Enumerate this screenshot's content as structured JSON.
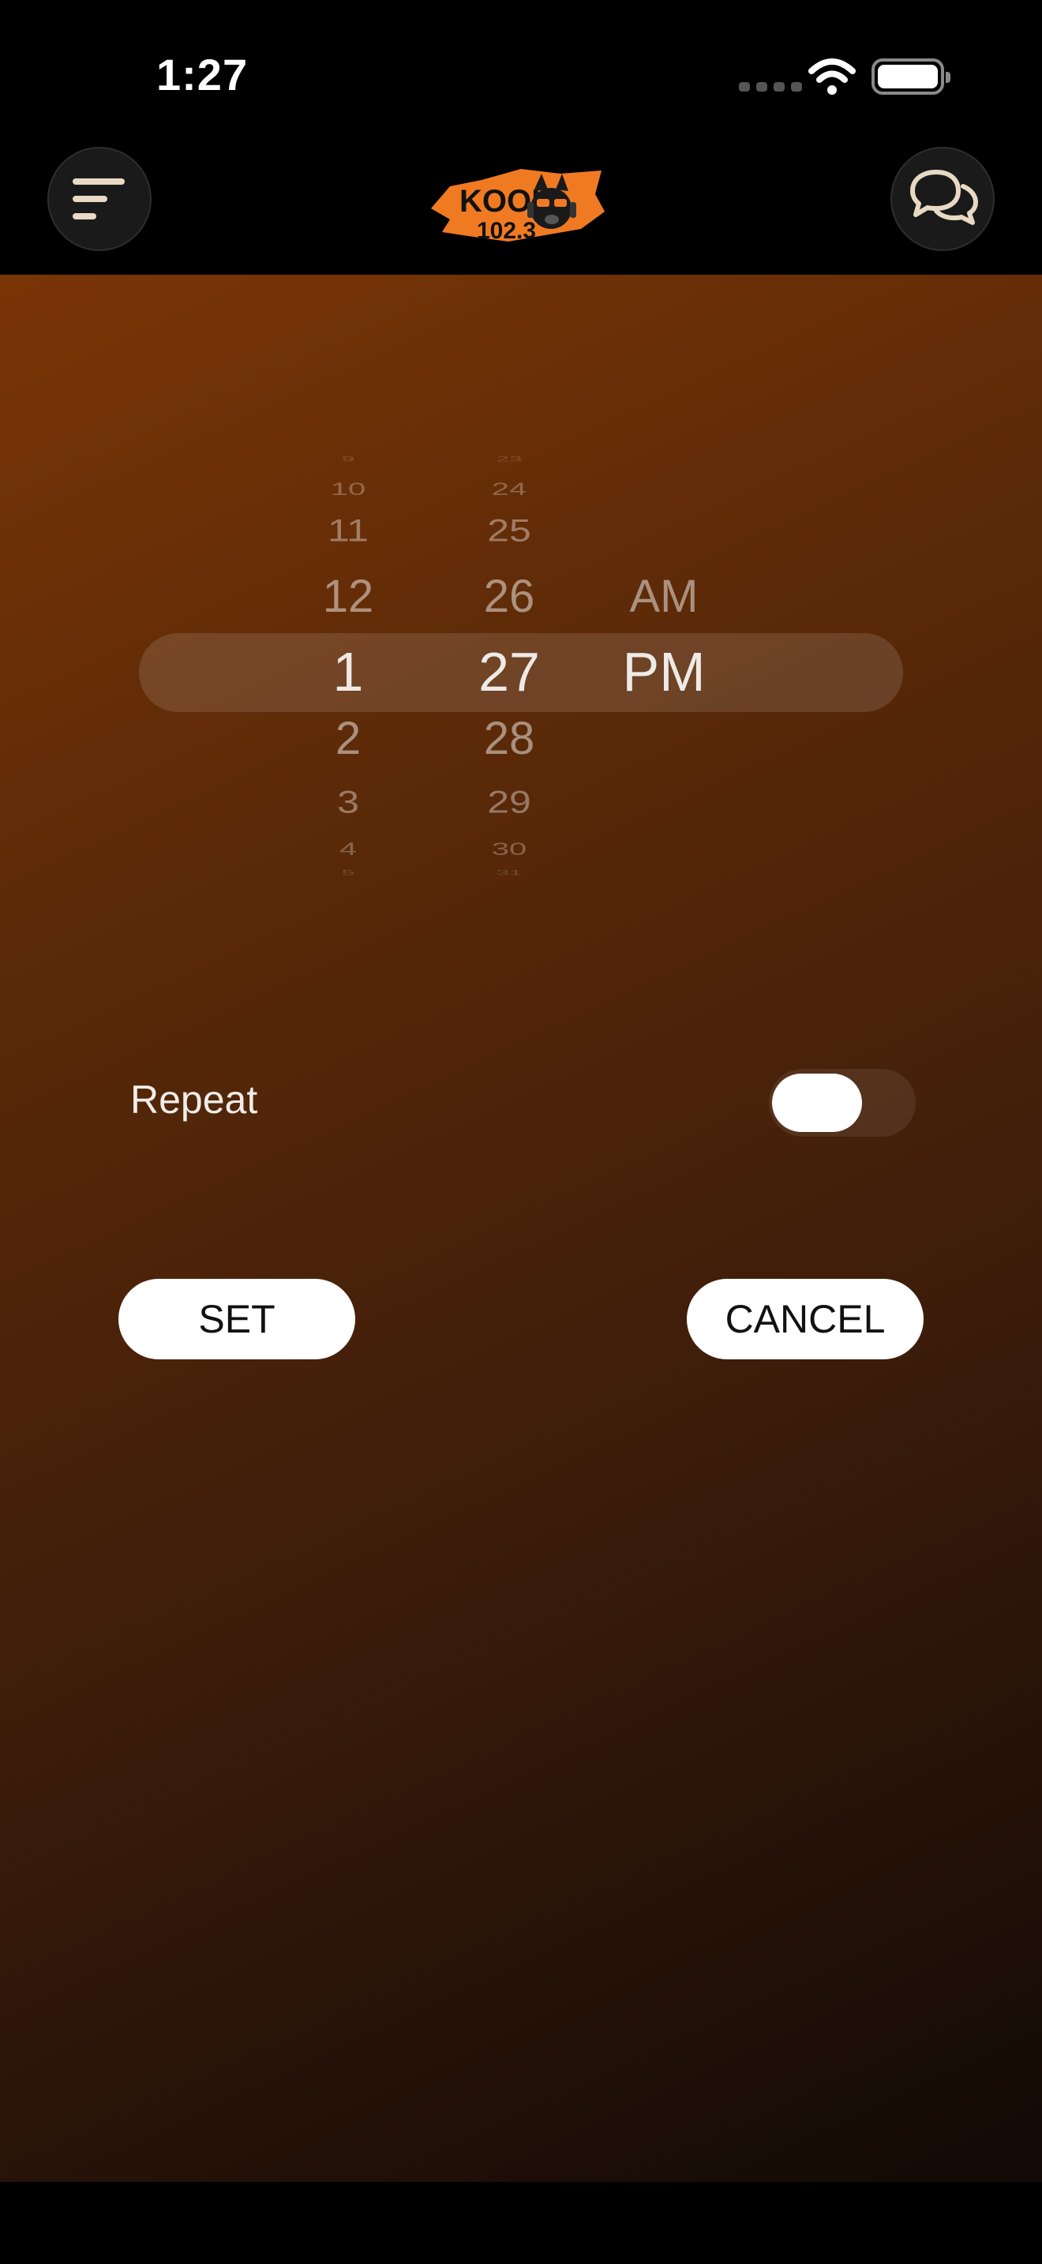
{
  "status_bar": {
    "time": "1:27"
  },
  "logo": {
    "text_top": "KOOL",
    "text_bottom": "102.3",
    "colors": {
      "splash": "#f07a22",
      "ink": "#111111"
    }
  },
  "picker": {
    "hours": {
      "n4": "9",
      "n3": "10",
      "n2": "11",
      "n1": "12",
      "selected": "1",
      "p1": "2",
      "p2": "3",
      "p3": "4",
      "p4": "5"
    },
    "minutes": {
      "n4": "23",
      "n3": "24",
      "n2": "25",
      "n1": "26",
      "selected": "27",
      "p1": "28",
      "p2": "29",
      "p3": "30",
      "p4": "31"
    },
    "ampm": {
      "n1": "AM",
      "selected": "PM"
    }
  },
  "repeat": {
    "label": "Repeat",
    "enabled": false
  },
  "actions": {
    "set_label": "SET",
    "cancel_label": "CANCEL"
  },
  "icons": {
    "menu": "menu-icon",
    "chat": "chat-bubbles-icon",
    "wifi": "wifi-icon",
    "battery": "battery-icon",
    "signal": "signal-icon"
  },
  "colors": {
    "accent": "#f07a22",
    "gradient_start": "#7a3506",
    "gradient_end": "#120a06",
    "icon_tint": "#e8d9c4"
  }
}
